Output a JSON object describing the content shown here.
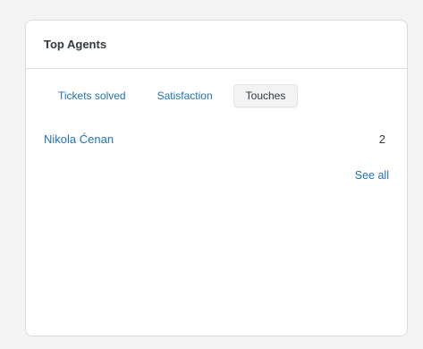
{
  "widget": {
    "title": "Top Agents",
    "tabs": [
      {
        "label": "Tickets solved",
        "active": false
      },
      {
        "label": "Satisfaction",
        "active": false
      },
      {
        "label": "Touches",
        "active": true
      }
    ],
    "agents": [
      {
        "name": "Nikola Ćenan",
        "value": "2"
      }
    ],
    "see_all_label": "See all"
  },
  "colors": {
    "link": "#1f73b7",
    "text": "#2f3941",
    "border": "#d8dcde",
    "background": "#f3f3f3"
  }
}
